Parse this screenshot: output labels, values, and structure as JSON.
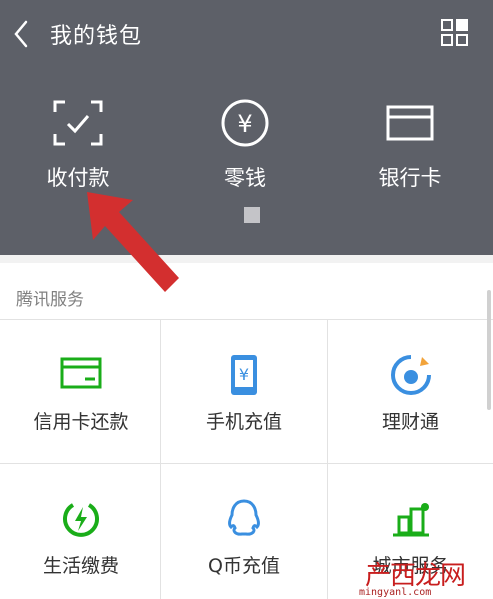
{
  "header": {
    "title": "我的钱包",
    "items": [
      {
        "label": "收付款",
        "icon": "scan-check-icon"
      },
      {
        "label": "零钱",
        "icon": "yuan-coin-icon"
      },
      {
        "label": "银行卡",
        "icon": "bank-card-icon"
      }
    ]
  },
  "section": {
    "title": "腾讯服务",
    "services": [
      {
        "label": "信用卡还款",
        "icon": "credit-card-icon"
      },
      {
        "label": "手机充值",
        "icon": "mobile-topup-icon"
      },
      {
        "label": "理财通",
        "icon": "wealth-icon"
      },
      {
        "label": "生活缴费",
        "icon": "utility-bolt-icon"
      },
      {
        "label": "Q币充值",
        "icon": "qq-penguin-icon"
      },
      {
        "label": "城市服务",
        "icon": "city-service-icon"
      }
    ]
  },
  "watermark": {
    "text": "产西龙网",
    "url": "mingyanl.com"
  },
  "colors": {
    "header_bg": "#5d6068",
    "accent_green": "#1aad19",
    "accent_blue": "#3a8fe0",
    "arrow_red": "#d32f2f"
  }
}
